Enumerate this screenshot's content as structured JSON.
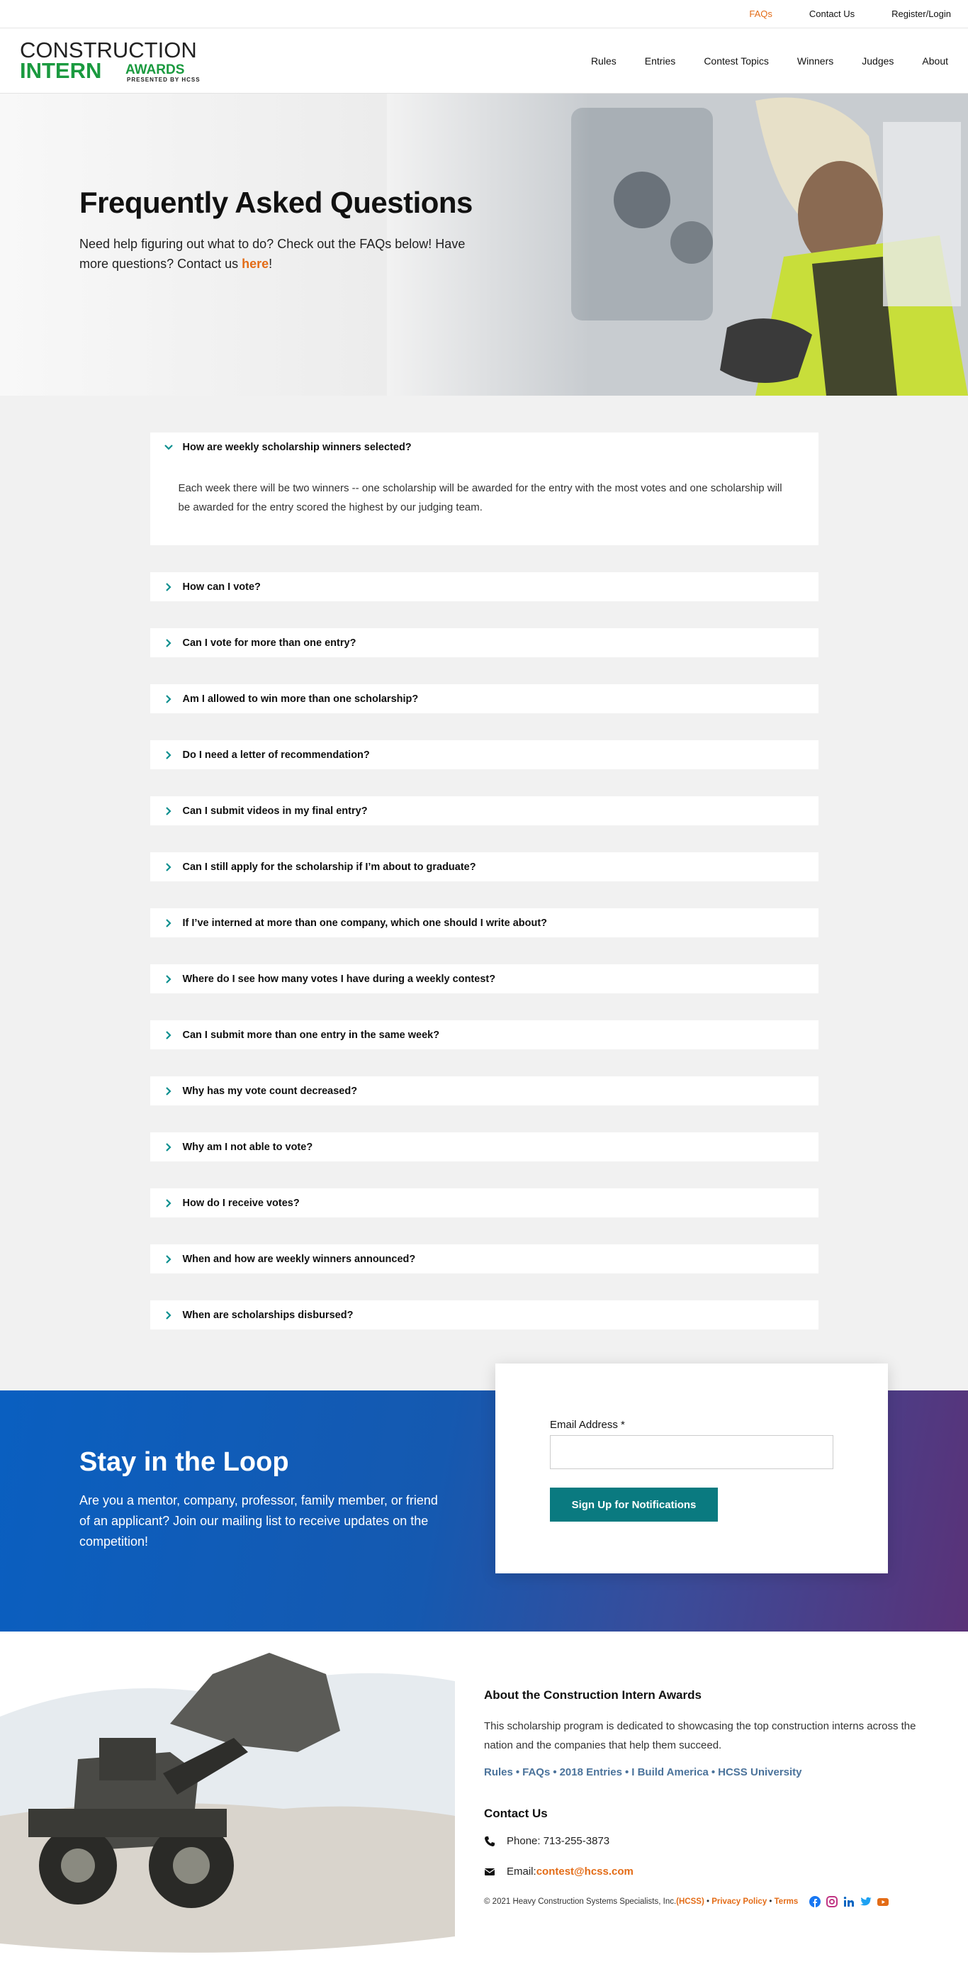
{
  "utility_nav": [
    {
      "label": "FAQs",
      "active": true
    },
    {
      "label": "Contact Us",
      "active": false
    },
    {
      "label": "Register/Login",
      "active": false
    }
  ],
  "logo": {
    "line1": "CONSTRUCTION",
    "line2a": "INTERN",
    "line2b": "AWARDS",
    "line3": "PRESENTED BY HCSS"
  },
  "main_nav": [
    "Rules",
    "Entries",
    "Contest Topics",
    "Winners",
    "Judges",
    "About"
  ],
  "hero": {
    "title": "Frequently Asked Questions",
    "text_before": "Need help figuring out what to do? Check out the FAQs below! Have more questions? Contact us ",
    "link": "here",
    "text_after": "!"
  },
  "faqs": [
    {
      "q": "How are weekly scholarship winners selected?",
      "open": true,
      "a": "Each week there will be two winners -- one scholarship will be awarded for the entry with the most votes and one scholarship will be awarded for the entry scored the highest by our judging team."
    },
    {
      "q": "How can I vote?",
      "open": false
    },
    {
      "q": "Can I vote for more than one entry?",
      "open": false
    },
    {
      "q": "Am I allowed to win more than one scholarship?",
      "open": false
    },
    {
      "q": "Do I need a letter of recommendation?",
      "open": false
    },
    {
      "q": "Can I submit videos in my final entry?",
      "open": false
    },
    {
      "q": "Can I still apply for the scholarship if I’m about to graduate?",
      "open": false
    },
    {
      "q": "If I’ve interned at more than one company, which one should I write about?",
      "open": false
    },
    {
      "q": "Where do I see how many votes I have during a weekly contest?",
      "open": false
    },
    {
      "q": "Can I submit more than one entry in the same week?",
      "open": false
    },
    {
      "q": "Why has my vote count decreased?",
      "open": false
    },
    {
      "q": "Why am I not able to vote?",
      "open": false
    },
    {
      "q": "How do I receive votes?",
      "open": false
    },
    {
      "q": "When and how are weekly winners announced?",
      "open": false
    },
    {
      "q": "When are scholarships disbursed?",
      "open": false
    }
  ],
  "loop": {
    "title": "Stay in the Loop",
    "text": "Are you a mentor, company, professor, family member, or friend of an applicant? Join our mailing list to receive updates on the competition!",
    "email_label": "Email Address *",
    "email_value": "",
    "button": "Sign Up for Notifications"
  },
  "footer": {
    "about_title": "About the Construction Intern Awards",
    "about_text": "This scholarship program is dedicated to showcasing the top construction interns across the nation and the companies that help them succeed.",
    "links": [
      "Rules",
      "FAQs",
      "2018 Entries",
      "I Build America",
      "HCSS University"
    ],
    "contact_title": "Contact Us",
    "phone": "Phone: 713-255-3873",
    "email_prefix": "Email: ",
    "email": "contest@hcss.com",
    "copyright": "© 2021 Heavy Construction Systems Specialists, Inc. ",
    "hcss": "(HCSS)",
    "privacy": "Privacy Policy",
    "terms": "Terms",
    "social": [
      "facebook-icon",
      "instagram-icon",
      "linkedin-icon",
      "twitter-icon",
      "youtube-icon"
    ]
  },
  "colors": {
    "accent": "#e36c17",
    "brand_green": "#1a9a3f",
    "teal": "#0a7a80",
    "link_blue": "#4b739b"
  }
}
